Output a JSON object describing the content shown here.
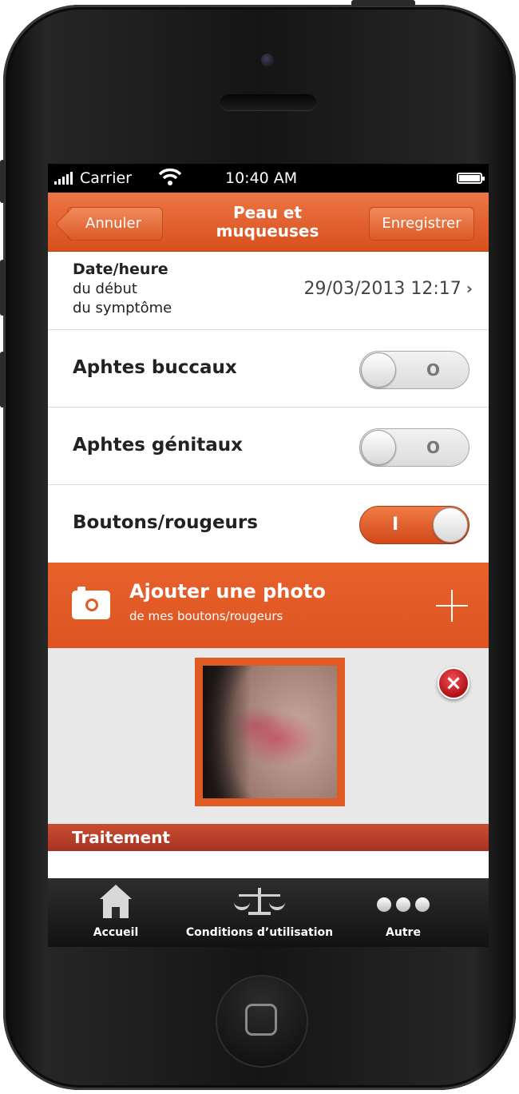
{
  "status_bar": {
    "carrier": "Carrier",
    "time": "10:40 AM"
  },
  "nav": {
    "back_label": "Annuler",
    "title_line1": "Peau et",
    "title_line2": "muqueuses",
    "save_label": "Enregistrer"
  },
  "date_row": {
    "label_bold": "Date/heure",
    "label_line2": "du début",
    "label_line3": "du symptôme",
    "value": "29/03/2013 12:17"
  },
  "toggles": [
    {
      "label": "Aphtes buccaux",
      "on": false,
      "mark": "O"
    },
    {
      "label": "Aphtes génitaux",
      "on": false,
      "mark": "O"
    },
    {
      "label": "Boutons/rougeurs",
      "on": true,
      "mark": "I"
    }
  ],
  "photo": {
    "title": "Ajouter une photo",
    "subtitle": "de mes boutons/rougeurs"
  },
  "section": {
    "title": "Traitement"
  },
  "tabbar": {
    "items": [
      {
        "label": "Accueil",
        "icon": "home-icon"
      },
      {
        "label": "Conditions d’utilisation",
        "icon": "scale-icon"
      },
      {
        "label": "Autre",
        "icon": "more-icon"
      }
    ]
  },
  "colors": {
    "accent": "#e05a24",
    "section": "#b23a26"
  }
}
